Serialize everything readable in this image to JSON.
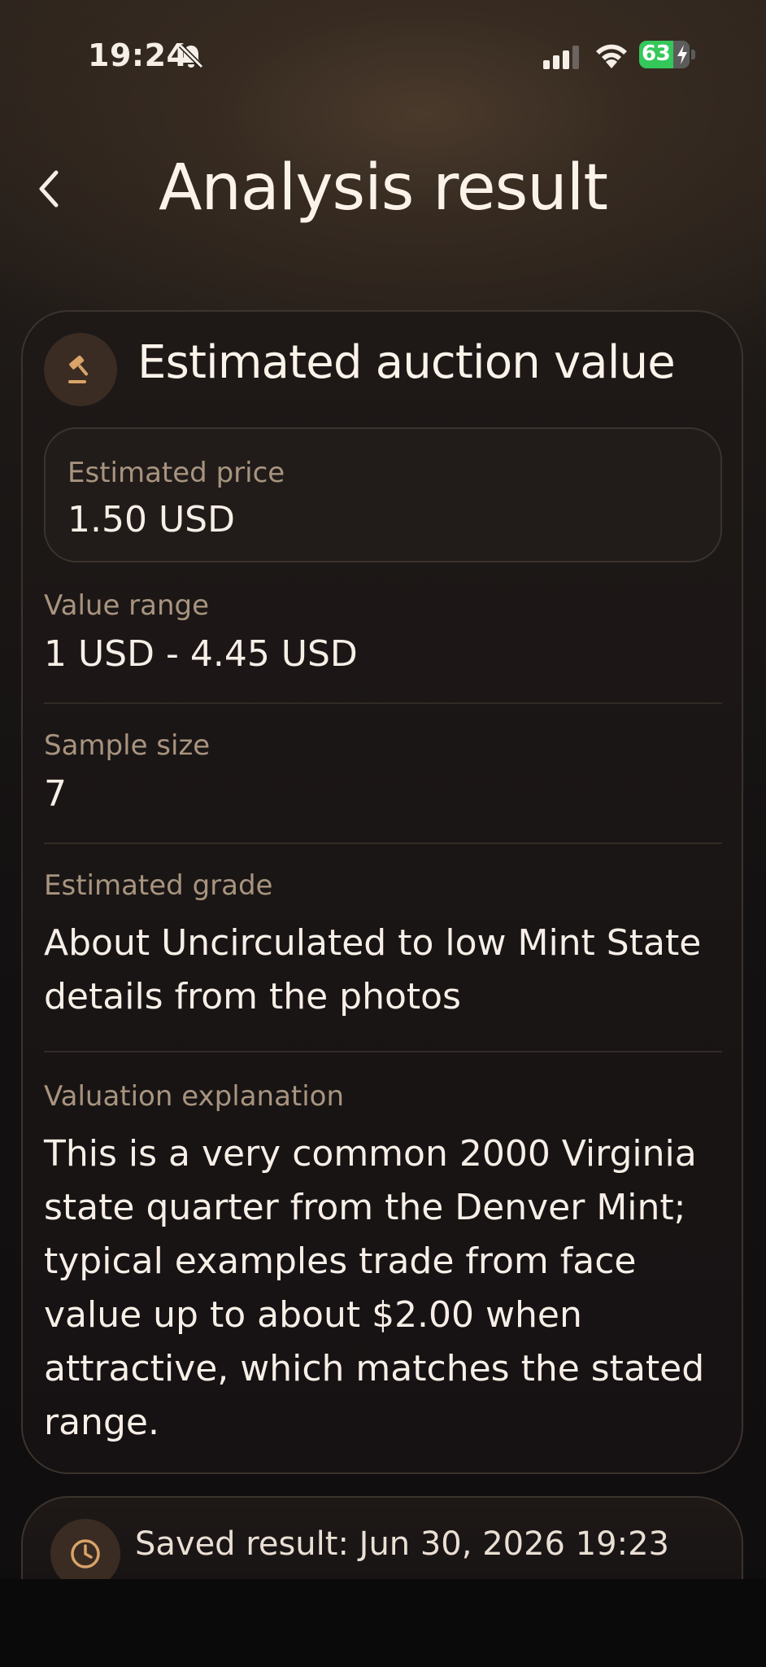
{
  "status_bar": {
    "time": "19:24",
    "battery_percent": "63"
  },
  "header": {
    "title": "Analysis result"
  },
  "auction_card": {
    "title": "Estimated auction value",
    "estimated_price_label": "Estimated price",
    "estimated_price_value": "1.50 USD",
    "value_range_label": "Value range",
    "value_range_value": "1 USD - 4.45 USD",
    "sample_size_label": "Sample size",
    "sample_size_value": "7",
    "estimated_grade_label": "Estimated grade",
    "estimated_grade_value": "About Uncirculated to low Mint State details from the photos",
    "valuation_explanation_label": "Valuation explanation",
    "valuation_explanation_value": "This is a very common 2000 Virginia state quarter from the Denver Mint; typical examples trade from face value up to about $2.00 when attractive, which matches the stated range."
  },
  "saved_card": {
    "text": "Saved result: Jun 30, 2026 19:23"
  },
  "colors": {
    "accent": "#d9a36a",
    "battery_green": "#34c759",
    "label": "#a8947f"
  }
}
